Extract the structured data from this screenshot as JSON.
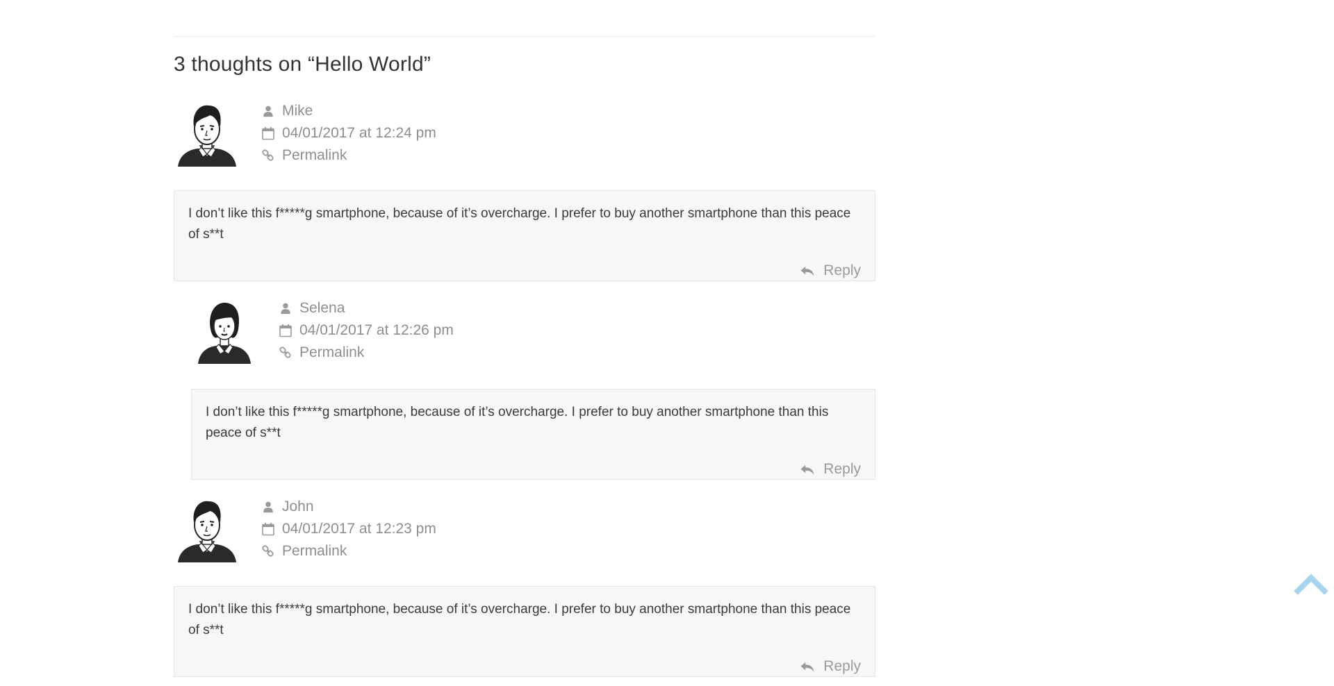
{
  "comments_section": {
    "title": "3 thoughts on “Hello World”"
  },
  "comments": [
    {
      "author": "Mike",
      "date": "04/01/2017 at 12:24 pm",
      "permalink": "Permalink",
      "text": "I don’t like this f*****g smartphone, because of it’s overcharge. I prefer to buy another smartphone than this peace of s**t",
      "reply": "Reply",
      "avatar": "male-avatar"
    },
    {
      "author": "Selena",
      "date": "04/01/2017 at 12:26 pm",
      "permalink": "Permalink",
      "text": "I don’t like this f*****g smartphone, because of it’s overcharge. I prefer to buy another smartphone than this peace of s**t",
      "reply": "Reply",
      "avatar": "female-avatar"
    },
    {
      "author": "John",
      "date": "04/01/2017 at 12:23 pm",
      "permalink": "Permalink",
      "text": "I don’t like this f*****g smartphone, because of it’s overcharge. I prefer to buy another smartphone than this peace of s**t",
      "reply": "Reply",
      "avatar": "male-avatar"
    }
  ],
  "icons": {
    "author": "user-icon",
    "date": "calendar-icon",
    "permalink": "link-icon",
    "reply": "reply-icon",
    "scroll_top": "chevron-up-icon"
  },
  "colors": {
    "meta_text": "#8e8e8e",
    "body_bg": "#f7f7f7",
    "scroll_top": "#a9d4ee"
  }
}
